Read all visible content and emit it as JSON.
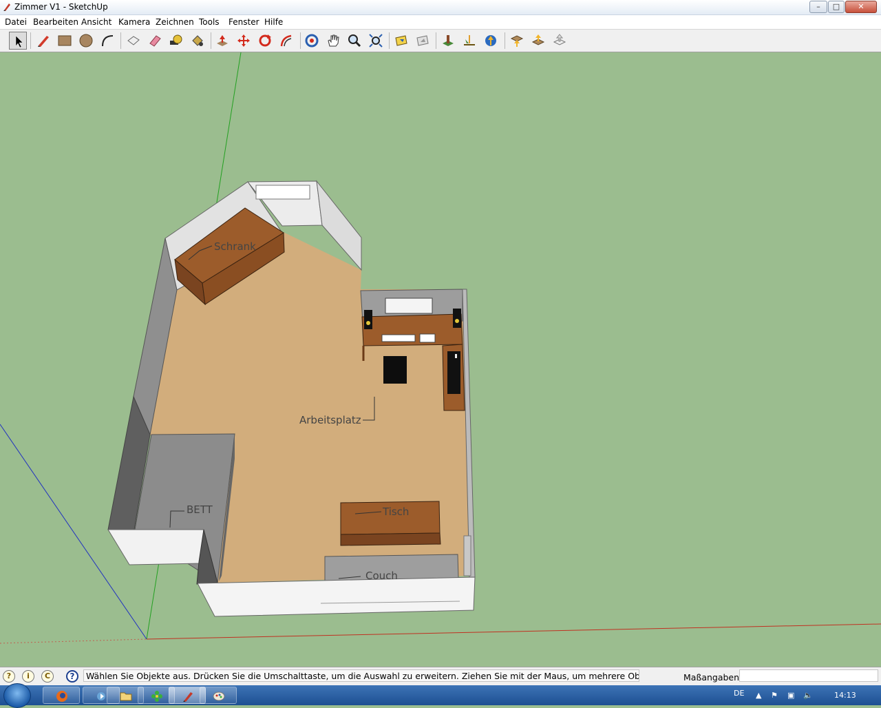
{
  "window": {
    "title": "Zimmer V1 - SketchUp"
  },
  "menu": [
    "Datei",
    "Bearbeiten",
    "Ansicht",
    "Kamera",
    "Zeichnen",
    "Tools",
    "Fenster",
    "Hilfe"
  ],
  "toolbar": {
    "tools": [
      {
        "name": "select-tool",
        "icon": "arrow-cursor-icon",
        "active": true
      },
      {
        "name": "line-tool",
        "icon": "pencil-icon"
      },
      {
        "name": "rectangle-tool",
        "icon": "rectangle-icon"
      },
      {
        "name": "circle-tool",
        "icon": "circle-icon"
      },
      {
        "name": "arc-tool",
        "icon": "arc-icon"
      },
      {
        "name": "make-component-tool",
        "icon": "component-icon"
      },
      {
        "name": "eraser-tool",
        "icon": "eraser-icon"
      },
      {
        "name": "tape-measure-tool",
        "icon": "tape-measure-icon"
      },
      {
        "name": "paint-bucket-tool",
        "icon": "paint-bucket-icon"
      },
      {
        "name": "push-pull-tool",
        "icon": "push-pull-icon"
      },
      {
        "name": "move-tool",
        "icon": "move-icon"
      },
      {
        "name": "rotate-tool",
        "icon": "rotate-icon"
      },
      {
        "name": "offset-tool",
        "icon": "offset-icon"
      },
      {
        "name": "orbit-tool",
        "icon": "orbit-icon"
      },
      {
        "name": "pan-tool",
        "icon": "hand-icon"
      },
      {
        "name": "zoom-tool",
        "icon": "magnifier-icon"
      },
      {
        "name": "zoom-extents-tool",
        "icon": "zoom-extents-icon"
      },
      {
        "name": "previous-view-tool",
        "icon": "previous-view-icon"
      },
      {
        "name": "next-view-tool",
        "icon": "next-view-icon"
      },
      {
        "name": "add-location-tool",
        "icon": "location-icon"
      },
      {
        "name": "toggle-terrain-tool",
        "icon": "terrain-icon"
      },
      {
        "name": "google-earth-tool",
        "icon": "globe-icon"
      },
      {
        "name": "get-models-tool",
        "icon": "get-models-icon"
      },
      {
        "name": "share-model-tool",
        "icon": "share-model-icon"
      },
      {
        "name": "share-component-tool",
        "icon": "share-component-icon"
      }
    ]
  },
  "scene": {
    "labels": {
      "schrank": "Schrank",
      "arbeitsplatz": "Arbeitsplatz",
      "bett": "BETT",
      "tisch": "Tisch",
      "couch": "Couch"
    },
    "colors": {
      "ground": "#9bbd8f",
      "floor": "#d2ad7c",
      "wall_top": "#e2e2e2",
      "wall_side": "#8f8f8f",
      "wood": "#9c5c2b",
      "bed": "#8c8c8c"
    }
  },
  "statusbar": {
    "message": "Wählen Sie Objekte aus. Drücken Sie die Umschalttaste, um die Auswahl zu erweitern. Ziehen Sie mit der Maus, um mehrere Objekte",
    "measure_label": "Maßangaben",
    "measure_value": ""
  },
  "taskbar": {
    "language": "DE",
    "clock": "14:13",
    "apps": [
      {
        "name": "firefox",
        "icon": "firefox-icon"
      },
      {
        "name": "media-player",
        "icon": "media-icon"
      },
      {
        "name": "explorer",
        "icon": "folder-icon"
      },
      {
        "name": "app-green",
        "icon": "flower-icon"
      },
      {
        "name": "sketchup",
        "icon": "sketchup-icon",
        "active": true
      },
      {
        "name": "paint",
        "icon": "paint-icon"
      }
    ]
  }
}
